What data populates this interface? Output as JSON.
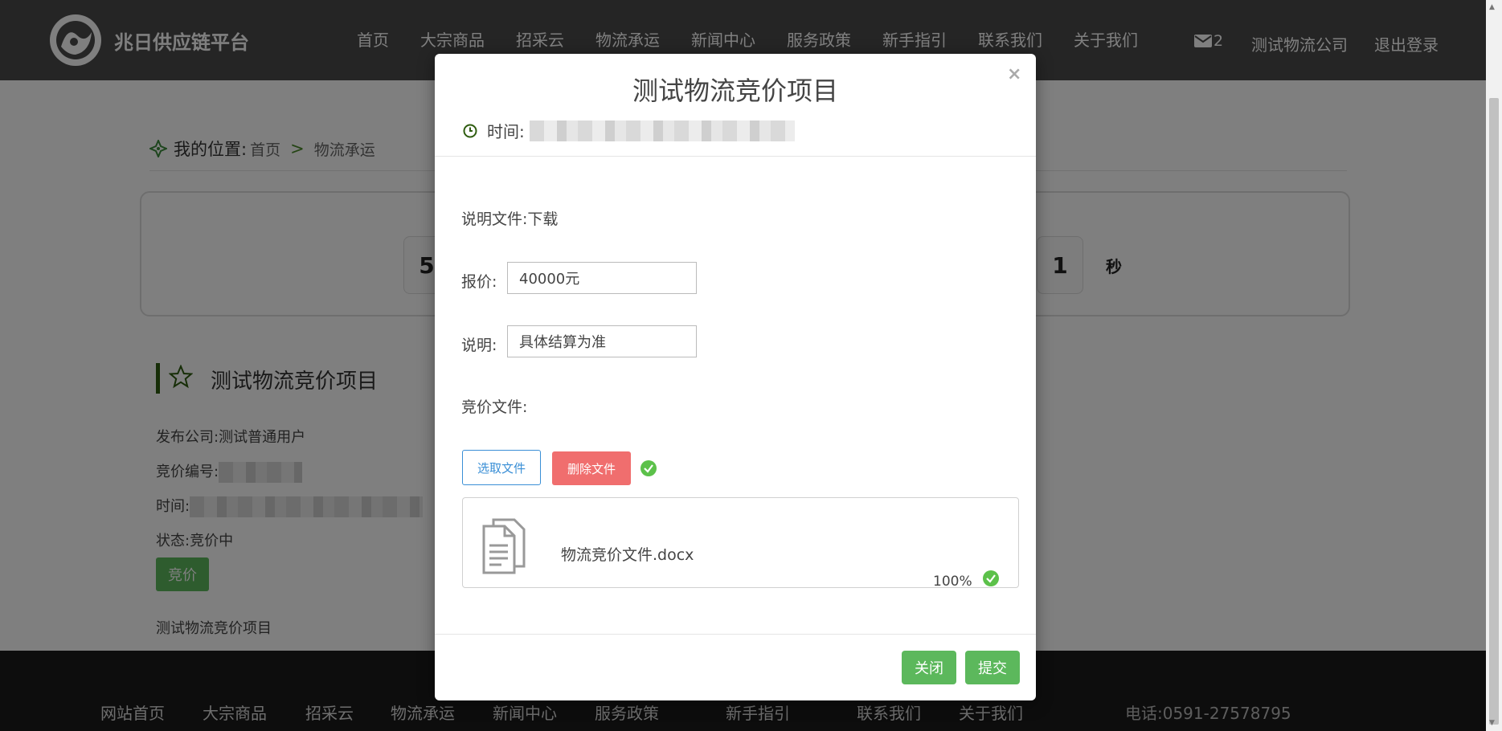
{
  "header": {
    "brand": "兆日供应链平台",
    "nav": [
      "首页",
      "大宗商品",
      "招采云",
      "物流承运",
      "新闻中心",
      "服务政策",
      "新手指引",
      "联系我们",
      "关于我们"
    ],
    "mail_count": "2",
    "company": "测试物流公司",
    "logout": "退出登录"
  },
  "breadcrumb": {
    "label": "我的位置:",
    "home": "首页",
    "separator": ">",
    "current": "物流承运"
  },
  "countdown": {
    "first_digit": "5",
    "last_digit": "1",
    "unit_seconds": "秒"
  },
  "project": {
    "title": "测试物流竞价项目",
    "publisher_label": "发布公司:",
    "publisher": "测试普通用户",
    "code_label": "竞价编号:",
    "time_label": "时间:",
    "status_label": "状态:",
    "status": "竞价中",
    "bid_button": "竞价",
    "description": "测试物流竞价项目"
  },
  "modal": {
    "title": "测试物流竞价项目",
    "time_label": "时间:",
    "doc_label": "说明文件:",
    "doc_link": "下载",
    "price_label": "报价:",
    "price_value": "40000元",
    "note_label": "说明:",
    "note_value": "具体结算为准",
    "bid_file_label": "竞价文件:",
    "pick_button": "选取文件",
    "delete_button": "删除文件",
    "file_name": "物流竞价文件.docx",
    "upload_progress": "100%",
    "close_button": "关闭",
    "submit_button": "提交",
    "close_x": "×"
  },
  "footer": {
    "nav": [
      "网站首页",
      "大宗商品",
      "招采云",
      "物流承运",
      "新闻中心",
      "服务政策",
      "新手指引",
      "联系我们",
      "关于我们"
    ],
    "phone": "电话:0591-27578795"
  },
  "colors": {
    "header_bg": "#4a4a4a",
    "accent_green": "#5cb85c",
    "danger_red": "#f06e6e",
    "link_blue": "#3a8fd6"
  }
}
